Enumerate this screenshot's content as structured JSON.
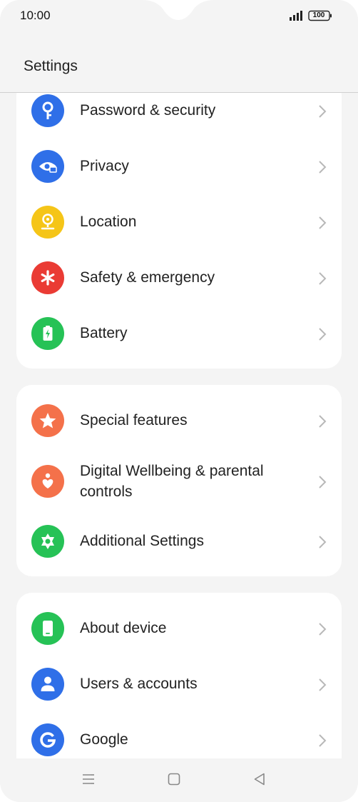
{
  "status_bar": {
    "time": "10:00",
    "battery": "100"
  },
  "header": {
    "title": "Settings"
  },
  "groups": [
    {
      "items": [
        {
          "label": "Password & security",
          "icon": "key-icon",
          "color": "#2f6fe8"
        },
        {
          "label": "Privacy",
          "icon": "privacy-eye-lock-icon",
          "color": "#2f6fe8"
        },
        {
          "label": "Location",
          "icon": "location-pin-icon",
          "color": "#f5c518"
        },
        {
          "label": "Safety & emergency",
          "icon": "asterisk-icon",
          "color": "#ea3b34"
        },
        {
          "label": "Battery",
          "icon": "battery-icon",
          "color": "#26c256"
        }
      ]
    },
    {
      "items": [
        {
          "label": "Special features",
          "icon": "star-icon",
          "color": "#f4714a"
        },
        {
          "label": "Digital Wellbeing & parental controls",
          "icon": "wellbeing-heart-icon",
          "color": "#f4714a"
        },
        {
          "label": "Additional Settings",
          "icon": "gear-icon",
          "color": "#26c256"
        }
      ]
    },
    {
      "items": [
        {
          "label": "About device",
          "icon": "phone-device-icon",
          "color": "#26c256"
        },
        {
          "label": "Users & accounts",
          "icon": "user-icon",
          "color": "#2f6fe8"
        },
        {
          "label": "Google",
          "icon": "google-icon",
          "color": "#2f6fe8"
        }
      ]
    }
  ],
  "navbar": {
    "buttons": [
      "menu-icon",
      "home-icon",
      "back-icon"
    ]
  }
}
